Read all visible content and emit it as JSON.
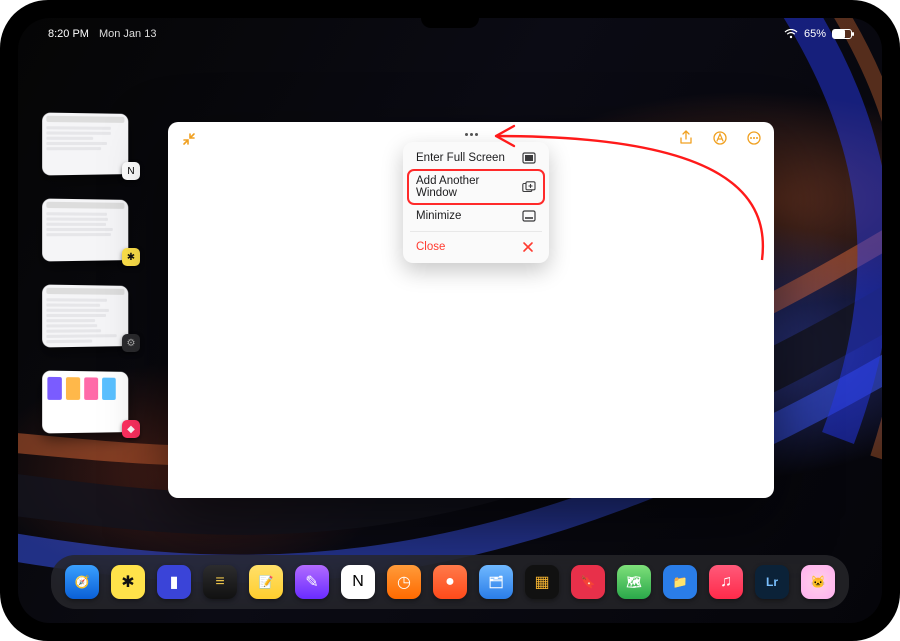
{
  "status": {
    "time": "8:20 PM",
    "date": "Mon Jan 13",
    "battery_pct": "65%"
  },
  "switcher_apps": [
    {
      "badge_name": "notion-app-icon",
      "badge_bg": "#ffffff",
      "badge_glyph": "N",
      "badge_fg": "#000"
    },
    {
      "badge_name": "butterfly-app-icon",
      "badge_bg": "#ffe24a",
      "badge_glyph": "✱",
      "badge_fg": "#111"
    },
    {
      "badge_name": "settings-app-icon",
      "badge_bg": "#2b2b2e",
      "badge_glyph": "⚙︎",
      "badge_fg": "#aaa"
    },
    {
      "badge_name": "raycast-app-icon",
      "badge_bg": "#ff3060",
      "badge_glyph": "◆",
      "badge_fg": "#fff"
    }
  ],
  "window": {
    "toolbar_icons": [
      "share-icon",
      "markup-icon",
      "more-icon"
    ],
    "menu": {
      "enter_full_screen": "Enter Full Screen",
      "add_another_window": "Add Another Window",
      "minimize": "Minimize",
      "close": "Close"
    }
  },
  "dock": [
    {
      "name": "safari-app",
      "bg": "linear-gradient(#3aa0ff,#0a5fd6)",
      "glyph": "🧭"
    },
    {
      "name": "butterfly-app",
      "bg": "#ffe24a",
      "glyph": "✱",
      "fg": "#111"
    },
    {
      "name": "linear-app",
      "bg": "#3a44d8",
      "glyph": "▮"
    },
    {
      "name": "bear-app",
      "bg": "linear-gradient(#2c2c2e,#111)",
      "glyph": "≡",
      "fg": "#e9c24a"
    },
    {
      "name": "notes-app",
      "bg": "linear-gradient(#ffe06a,#ffce2e)",
      "glyph": "📝"
    },
    {
      "name": "craft-app",
      "bg": "linear-gradient(#b26bff,#6a2cff)",
      "glyph": "✎"
    },
    {
      "name": "notion-app",
      "bg": "#fff",
      "glyph": "N",
      "fg": "#000"
    },
    {
      "name": "clock-app",
      "bg": "linear-gradient(#ff9b3a,#ff6a00)",
      "glyph": "◷"
    },
    {
      "name": "todoist-app",
      "bg": "linear-gradient(#ff7a4a,#ff4a1a)",
      "glyph": "●"
    },
    {
      "name": "files-app",
      "bg": "linear-gradient(#6fb8ff,#2a7de8)",
      "glyph": "🗂"
    },
    {
      "name": "things-app",
      "bg": "#111",
      "glyph": "▦",
      "fg": "#f0b030"
    },
    {
      "name": "bookmark-app",
      "bg": "#e8304a",
      "glyph": "🔖"
    },
    {
      "name": "maps-app",
      "bg": "linear-gradient(#7ee07a,#2aa84a)",
      "glyph": "🗺"
    },
    {
      "name": "folder-app",
      "bg": "#2a7de8",
      "glyph": "📁"
    },
    {
      "name": "music-app",
      "bg": "linear-gradient(#ff5a7a,#ff2a4a)",
      "glyph": "♫"
    },
    {
      "name": "lightroom-app",
      "bg": "#0b2238",
      "glyph": "Lr",
      "fg": "#7ac0ff"
    },
    {
      "name": "assistant-app",
      "bg": "radial-gradient(circle,#ffd0e8,#ffb0f0)",
      "glyph": "🐱"
    }
  ]
}
